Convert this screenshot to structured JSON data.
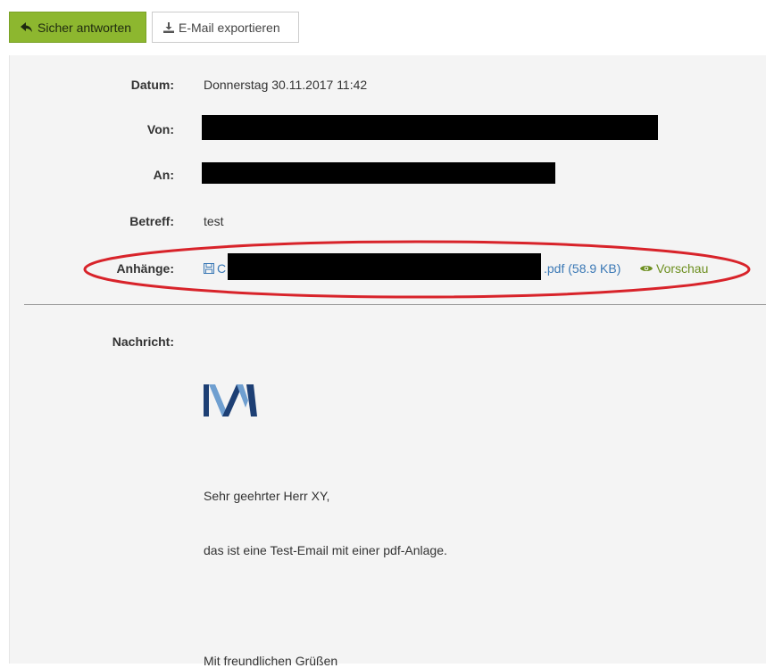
{
  "toolbar": {
    "reply_label": "Sicher antworten",
    "export_label": "E-Mail exportieren"
  },
  "header": {
    "date_label": "Datum:",
    "date_value": "Donnerstag 30.11.2017 11:42",
    "from_label": "Von:",
    "to_label": "An:",
    "subject_label": "Betreff:",
    "subject_value": "test",
    "attachments_label": "Anhänge:",
    "attachment_name_start": "C",
    "attachment_name_end": ".pdf (58.9 KB)",
    "preview_label": "Vorschau"
  },
  "message": {
    "label": "Nachricht:",
    "greeting": "Sehr geehrter Herr XY,",
    "body": "das ist eine Test-Email mit einer pdf-Anlage.",
    "closing": "Mit freundlichen Grüßen"
  },
  "colors": {
    "primary_button": "#8db72f",
    "link": "#3a78b5",
    "preview": "#6d8f1f",
    "annotation": "#d8232a",
    "logo_dark": "#1d3f74",
    "logo_light": "#6f9fd0"
  }
}
